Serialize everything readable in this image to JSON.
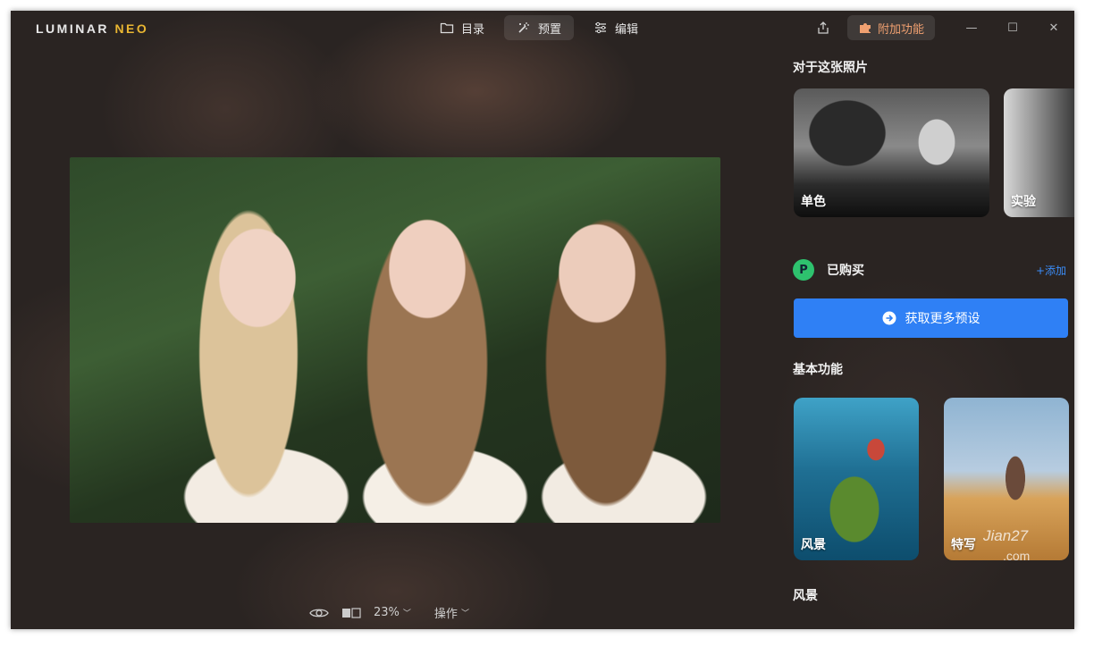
{
  "app": {
    "brand": "LUMINAR",
    "brand_accent": "NEO"
  },
  "nav": {
    "catalog": "目录",
    "presets": "预置",
    "edit": "编辑"
  },
  "topbar": {
    "addons": "附加功能"
  },
  "bottombar": {
    "zoom": "23%",
    "actions": "操作"
  },
  "panel": {
    "about_photo": "对于这张照片",
    "cards_top": [
      "单色",
      "实验"
    ],
    "purchased": "已购买",
    "purchased_icon_letter": "P",
    "add_link": "+添加",
    "get_more": "获取更多预设",
    "basic_functions": "基本功能",
    "cards_basic": [
      "风景",
      "特写"
    ],
    "landscape": "风景"
  },
  "watermark": {
    "text": "Jian27",
    "domain": ".com"
  },
  "colors": {
    "accent_blue": "#2f80f5",
    "purchased_green": "#2ec26e",
    "addon_orange": "#f0a070",
    "brand_yellow": "#e9b632"
  }
}
